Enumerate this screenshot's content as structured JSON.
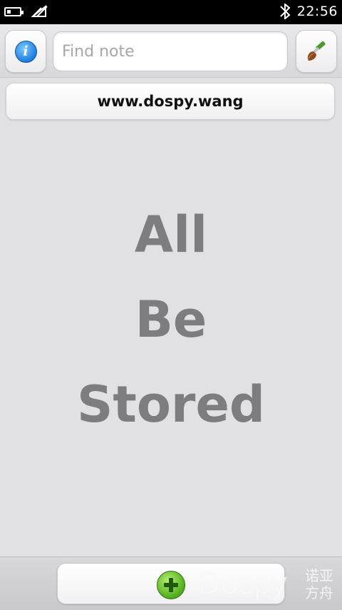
{
  "status_bar": {
    "time": "22:56",
    "icons": [
      "battery-icon",
      "no-signal-icon",
      "bluetooth-icon"
    ]
  },
  "toolbar": {
    "info_icon": "info-icon",
    "info_glyph": "i",
    "search": {
      "placeholder": "Find note",
      "value": ""
    },
    "clean_icon": "brush-icon"
  },
  "url_bar": {
    "text": "www.dospy.wang"
  },
  "empty_state": {
    "lines": [
      "All",
      "Be",
      "Stored"
    ]
  },
  "bottom_bar": {
    "add_icon": "plus-icon",
    "watermark": "Dospy",
    "watermark_cn": "诺亚方舟"
  },
  "colors": {
    "background": "#e1e1e3",
    "empty_text": "#7d7d7f",
    "info_blue": "#1d7fe0",
    "add_green": "#55b21e"
  }
}
